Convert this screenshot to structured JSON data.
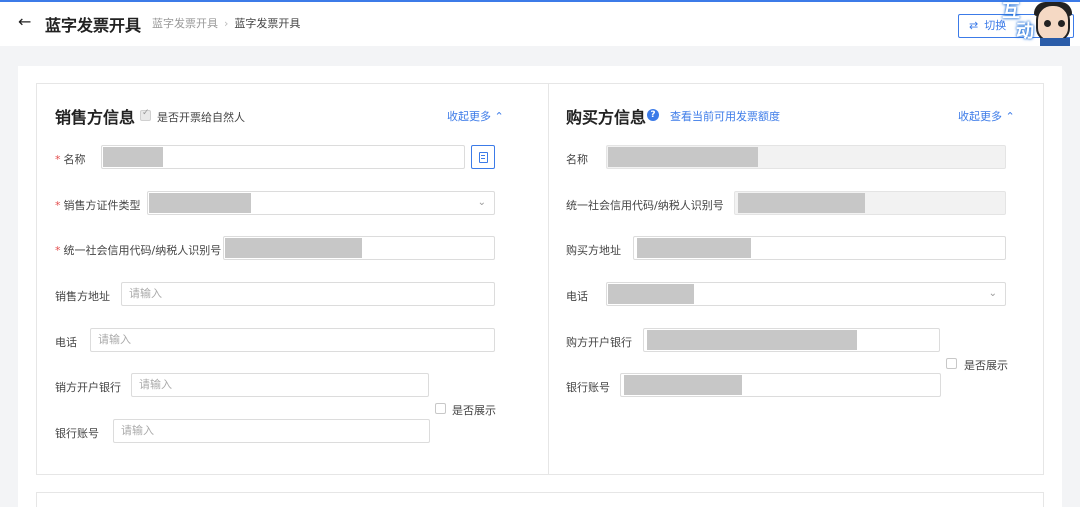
{
  "header": {
    "title": "蓝字发票开具",
    "breadcrumb": [
      "蓝字发票开具",
      "蓝字发票开具"
    ],
    "switch_label": "切换",
    "mascot_text_1": "互",
    "mascot_text_2": "动"
  },
  "seller": {
    "title": "销售方信息",
    "natural_person_label": "是否开票给自然人",
    "natural_person_checked": true,
    "collapse_label": "收起更多",
    "fields": {
      "name": {
        "label": "名称",
        "required": true
      },
      "id_type": {
        "label": "销售方证件类型",
        "required": true
      },
      "tax_id": {
        "label": "统一社会信用代码/纳税人识别号",
        "required": true
      },
      "address": {
        "label": "销售方地址",
        "placeholder": "请输入"
      },
      "phone": {
        "label": "电话",
        "placeholder": "请输入"
      },
      "bank": {
        "label": "销方开户银行",
        "placeholder": "请输入"
      },
      "account": {
        "label": "银行账号",
        "placeholder": "请输入"
      }
    },
    "show_label": "是否展示"
  },
  "buyer": {
    "title": "购买方信息",
    "quota_link": "查看当前可用发票额度",
    "collapse_label": "收起更多",
    "fields": {
      "name": {
        "label": "名称"
      },
      "tax_id": {
        "label": "统一社会信用代码/纳税人识别号"
      },
      "address": {
        "label": "购买方地址"
      },
      "phone": {
        "label": "电话"
      },
      "bank": {
        "label": "购方开户银行"
      },
      "account": {
        "label": "银行账号"
      }
    },
    "show_label": "是否展示"
  },
  "colors": {
    "accent": "#3c7be8",
    "required": "#e34d4d"
  },
  "icons": [
    "back-arrow-icon",
    "chevron-right-icon",
    "check-icon",
    "help-icon",
    "chevron-up-icon",
    "chevron-down-icon",
    "address-book-icon",
    "switch-icon"
  ]
}
